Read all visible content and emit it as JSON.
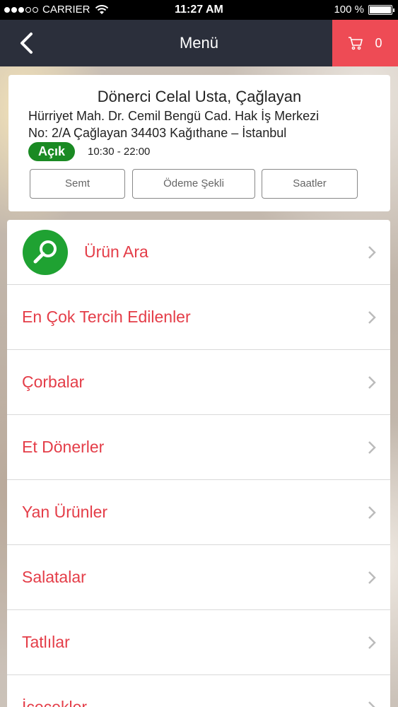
{
  "status_bar": {
    "carrier": "CARRIER",
    "time": "11:27 AM",
    "battery": "100 %"
  },
  "nav": {
    "title": "Menü",
    "cart_count": "0"
  },
  "restaurant": {
    "name": "Dönerci Celal Usta, Çağlayan",
    "address_line1": "Hürriyet Mah. Dr. Cemil Bengü Cad. Hak İş Merkezi",
    "address_line2": "No: 2/A Çağlayan 34403 Kağıthane – İstanbul",
    "status": "Açık",
    "hours": "10:30 - 22:00",
    "buttons": {
      "semt": "Semt",
      "odeme": "Ödeme Şekli",
      "saatler": "Saatler"
    }
  },
  "menu": {
    "items": [
      {
        "label": "Ürün Ara"
      },
      {
        "label": "En Çok Tercih Edilenler"
      },
      {
        "label": "Çorbalar"
      },
      {
        "label": "Et Dönerler"
      },
      {
        "label": "Yan Ürünler"
      },
      {
        "label": "Salatalar"
      },
      {
        "label": "Tatlılar"
      },
      {
        "label": "İçecekler"
      }
    ]
  },
  "colors": {
    "nav_bg": "#2b2f3b",
    "cart_bg": "#ee4b55",
    "accent_red": "#e43d48",
    "open_green": "#1a8a23",
    "search_green": "#1fa232"
  }
}
